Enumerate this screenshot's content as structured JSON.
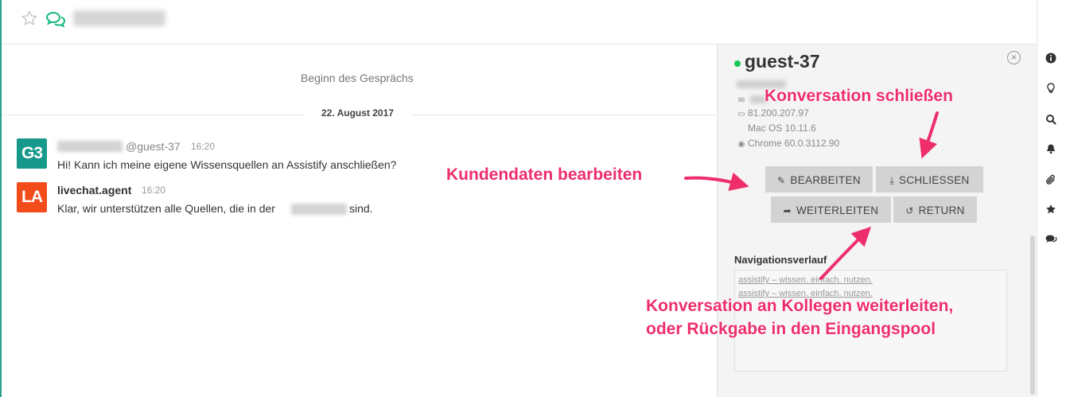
{
  "header": {
    "star_icon": "star-outline-icon",
    "chat_icon": "chat-bubbles-icon"
  },
  "chat": {
    "conversation_start": "Beginn des Gesprächs",
    "date_divider": "22. August 2017",
    "messages": [
      {
        "avatar": "G3",
        "avatar_color": "#16998b",
        "username": "@guest-37",
        "time": "16:20",
        "text": "Hi! Kann ich meine eigene Wissensquellen an Assistify anschließen?"
      },
      {
        "avatar": "LA",
        "avatar_color": "#f24c1b",
        "username": "livechat.agent",
        "time": "16:20",
        "text_before": "Klar, wir unterstützen alle Quellen, die in der",
        "text_after": "sind."
      }
    ]
  },
  "panel": {
    "title": "guest-37",
    "status_color": "#18c75b",
    "ip": "81.200.207.97",
    "os": "Mac OS 10.11.6",
    "browser": "Chrome 60.0.3112.90",
    "buttons": {
      "edit": "BEARBEITEN",
      "close": "SCHLIESSEN",
      "forward": "WEITERLEITEN",
      "return": "RETURN"
    },
    "nav_history_label": "Navigationsverlauf",
    "nav_history": [
      "assistify – wissen. einfach. nutzen.",
      "assistify – wissen. einfach. nutzen."
    ]
  },
  "toolbar": [
    "info-icon",
    "lightbulb-icon",
    "search-icon",
    "bell-icon",
    "paperclip-icon",
    "star-icon",
    "chat-icon"
  ],
  "annotations": {
    "close": "Konversation schließen",
    "edit": "Kundendaten bearbeiten",
    "forward_line1": "Konversation an Kollegen weiterleiten,",
    "forward_line2": "oder Rückgabe in den Eingangspool",
    "color": "#ee2e6b"
  }
}
